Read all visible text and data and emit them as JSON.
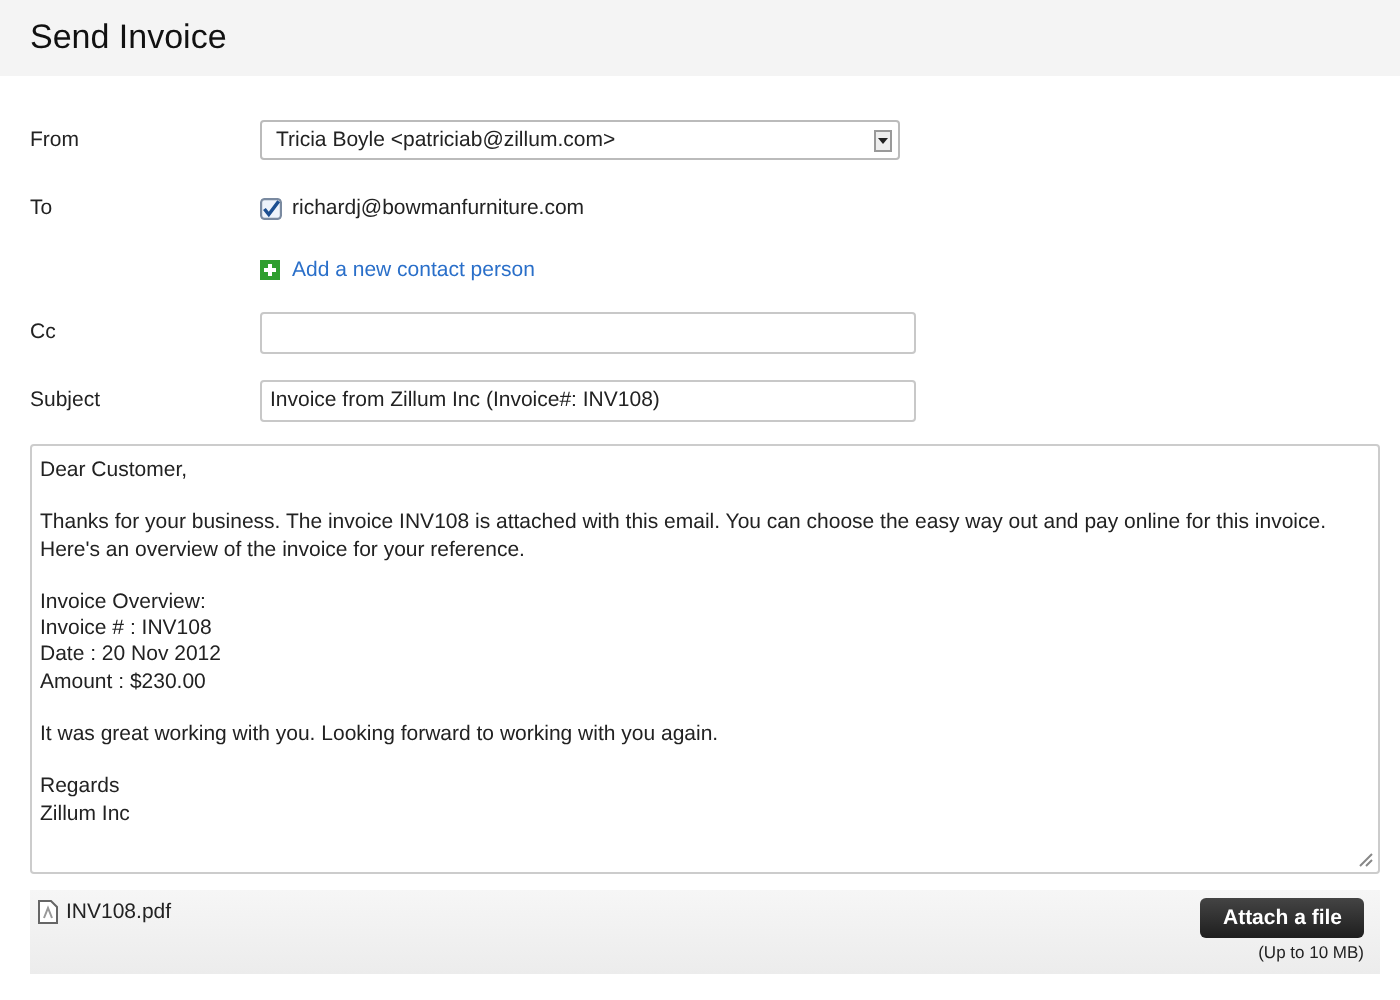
{
  "header": {
    "title": "Send Invoice"
  },
  "from": {
    "label": "From",
    "value": "Tricia Boyle <patriciab@zillum.com>"
  },
  "to": {
    "label": "To",
    "recipients": [
      {
        "email": "richardj@bowmanfurniture.com",
        "checked": true
      }
    ],
    "add_link": "Add a new contact person"
  },
  "cc": {
    "label": "Cc"
  },
  "subject": {
    "label": "Subject",
    "value": "Invoice from Zillum Inc (Invoice#: INV108)"
  },
  "body": [
    {
      "lines": [
        "Dear Customer,"
      ]
    },
    {
      "lines": [
        "Thanks for your business. The invoice INV108 is attached with this email. You can choose the easy way out and pay online for this invoice.",
        "Here's an overview of the invoice for your reference."
      ]
    },
    {
      "lines": [
        "Invoice Overview:",
        "Invoice # : INV108",
        "Date : 20 Nov 2012",
        "Amount : $230.00"
      ]
    },
    {
      "lines": [
        "It was great working with you. Looking forward to working with you again."
      ]
    },
    {
      "lines": [
        "Regards",
        "Zillum Inc"
      ]
    }
  ],
  "attachments": {
    "files": [
      {
        "name": "INV108.pdf"
      }
    ],
    "button": "Attach a file",
    "note": "(Up to 10 MB)"
  }
}
